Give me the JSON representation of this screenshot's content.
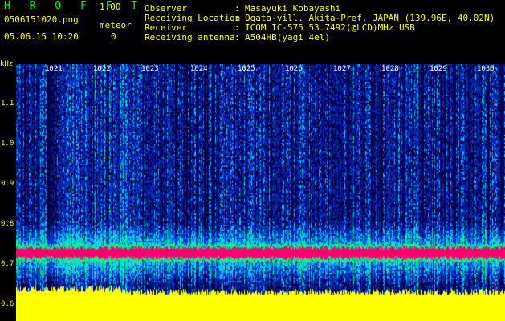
{
  "app": {
    "title": "H R O F F T",
    "version": "1.00",
    "filename": "0506151020.png",
    "meteor_label": "meteor",
    "meteor_count": "0",
    "datetime": "05.06.15 10:20"
  },
  "info": [
    {
      "label": "Observer",
      "value": "Masayuki Kobayashi"
    },
    {
      "label": "Receiving Location",
      "value": "Ogata-vill. Akita-Pref. JAPAN (139.96E, 40.02N)"
    },
    {
      "label": "Receiver",
      "value": "ICOM IC-575 53.7492(@LCD)MHz USB"
    },
    {
      "label": "Receiving antenna",
      "value": "A504HB(yagi 4el)"
    }
  ],
  "separator": ":",
  "spectrogram": {
    "y_unit": "kHz",
    "y_ticks": [
      "1.1",
      "1.0",
      "0.9",
      "0.8",
      "0.7",
      "0.6"
    ],
    "y_tick_values": [
      1.1,
      1.0,
      0.9,
      0.8,
      0.7,
      0.6
    ],
    "y_range": [
      0.55,
      1.2
    ],
    "x_ticks": [
      "1021",
      "1022",
      "1023",
      "1024",
      "1025",
      "1026",
      "1027",
      "1028",
      "1029",
      "1030"
    ],
    "carrier_khz": 0.73,
    "colors": {
      "noise_dark": "#00004a",
      "noise_blue": "#0033cc",
      "noise_cyan": "#00c8ff",
      "noise_green": "#00ff80",
      "carrier": "#ff0070",
      "floor": "#ffff00"
    }
  }
}
